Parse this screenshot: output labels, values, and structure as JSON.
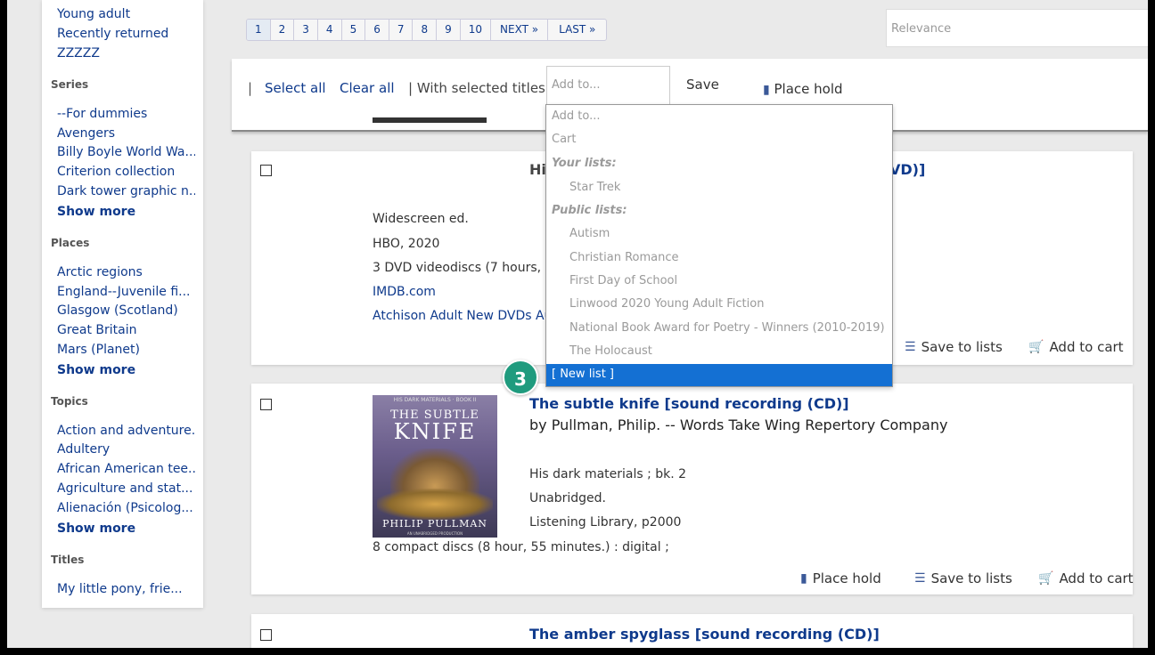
{
  "sidebar": {
    "top_items": [
      "Young adult",
      "Recently returned",
      "ZZZZZ"
    ],
    "series": {
      "heading": "Series",
      "items": [
        "--For dummies",
        "Avengers",
        "Billy Boyle World Wa...",
        "Criterion collection",
        "Dark tower graphic n..."
      ],
      "more": "Show more"
    },
    "places": {
      "heading": "Places",
      "items": [
        "Arctic regions",
        "England--Juvenile fi...",
        "Glasgow (Scotland)",
        "Great Britain",
        "Mars (Planet)"
      ],
      "more": "Show more"
    },
    "topics": {
      "heading": "Topics",
      "items": [
        "Action and adventure...",
        "Adultery",
        "African American tee...",
        "Agriculture and stat...",
        "Alienación (Psicolog..."
      ],
      "more": "Show more"
    },
    "titles": {
      "heading": "Titles",
      "items": [
        "My little pony, frie..."
      ]
    }
  },
  "pagination": {
    "pages": [
      "1",
      "2",
      "3",
      "4",
      "5",
      "6",
      "7",
      "8",
      "9",
      "10"
    ],
    "next": "NEXT »",
    "last": "LAST »"
  },
  "sort": {
    "placeholder": "Relevance"
  },
  "toolbar": {
    "sep": "|",
    "select_all": "Select all",
    "clear_all": "Clear all",
    "with_selected": "| With selected titles:",
    "add_to": "Add to...",
    "save": "Save",
    "place_hold": "Place hold"
  },
  "dropdown": {
    "add_to": "Add to...",
    "cart": "Cart",
    "your_lists_label": "Your lists:",
    "your_lists": [
      "Star Trek"
    ],
    "public_lists_label": "Public lists:",
    "public_lists": [
      "Autism",
      "Christian Romance",
      "First Day of School",
      "Linwood 2020 Young Adult Fiction",
      "National Book Award for Poetry - Winners (2010-2019)",
      "The Holocaust"
    ],
    "new_list": "[ New list ]"
  },
  "step_badge": "3",
  "results": [
    {
      "title_start": "Hi",
      "title_end": "VD)]",
      "details": [
        "Widescreen ed.",
        "HBO, 2020",
        "3 DVD videodiscs (7 hours, 40 m"
      ],
      "link1": "IMDB.com",
      "link2": "Atchison Adult New DVDs Augu",
      "save_to_lists": "Save to lists",
      "add_to_cart": "Add to cart"
    },
    {
      "title": "The subtle knife [sound recording (CD)]",
      "author": "by Pullman, Philip. -- Words Take Wing Repertory Company",
      "series": "His dark materials ; bk. 2",
      "edition": "Unabridged.",
      "publisher": "Listening Library, p2000",
      "physical": "8 compact discs (8 hour, 55 minutes.) : digital ;",
      "place_hold": "Place hold",
      "save_to_lists": "Save to lists",
      "add_to_cart": "Add to cart",
      "cover": {
        "line1": "HIS DARK MATERIALS · BOOK II",
        "line2": "THE SUBTLE",
        "line3": "KNIFE",
        "author": "PHILIP PULLMAN",
        "footer": "AN UNABRIDGED PRODUCTION"
      }
    },
    {
      "title": "The amber spyglass [sound recording (CD)]"
    }
  ]
}
